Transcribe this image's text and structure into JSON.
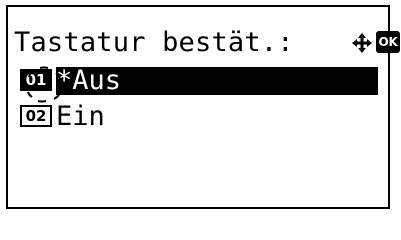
{
  "screen": {
    "title": "Tastatur bestät.:",
    "nav_icon": "four-way-arrows-icon",
    "ok_label": "OK"
  },
  "options": [
    {
      "number": "01",
      "label": "*Aus",
      "selected": true
    },
    {
      "number": "02",
      "label": " Ein",
      "selected": false
    }
  ],
  "colors": {
    "foreground": "#000000",
    "background": "#ffffff"
  }
}
